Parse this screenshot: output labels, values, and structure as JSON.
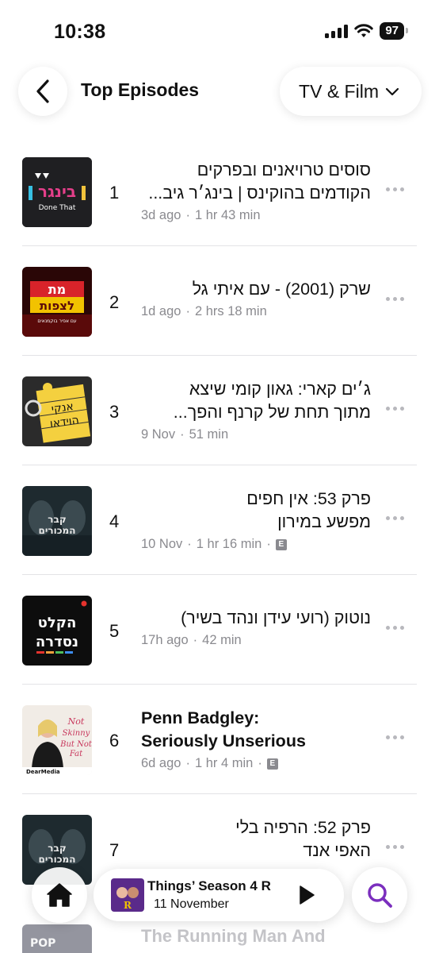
{
  "status_bar": {
    "time": "10:38",
    "battery": "97"
  },
  "header": {
    "back_icon": "chevron-left-icon",
    "title": "Top Episodes",
    "filter_label": "TV & Film",
    "filter_icon": "chevron-down-icon"
  },
  "episodes": [
    {
      "rank": "1",
      "title_line1": "סוסים טרויאנים ובפרקים",
      "title_line2": "הקודמים בהוקינס | בינג׳ר גיב...",
      "date": "3d ago",
      "duration": "1 hr 43 min",
      "explicit": false,
      "artwork_text": "בינגר",
      "artwork_sub": "Done That"
    },
    {
      "rank": "2",
      "title_line1": "שרק (2001) - עם איתי גל",
      "title_line2": "",
      "date": "1d ago",
      "duration": "2 hrs 18 min",
      "explicit": false,
      "artwork_text": "מת לצפות",
      "artwork_sub": "עם אפיר בוקמנאים"
    },
    {
      "rank": "3",
      "title_line1": "ג׳ים קארי: גאון קומי שיצא",
      "title_line2": "מתוך תחת של קרנף והפך...",
      "date": "9 Nov",
      "duration": "51 min",
      "explicit": false,
      "artwork_text": "אנקי הוידאו",
      "artwork_sub": ""
    },
    {
      "rank": "4",
      "title_line1": "פרק 53: אין חפים",
      "title_line2": "מפשע במירון",
      "date": "10 Nov",
      "duration": "1 hr 16 min",
      "explicit": true,
      "artwork_text": "קבר המכורים",
      "artwork_sub": ""
    },
    {
      "rank": "5",
      "title_line1": "נוטוק (רועי עידן ונהד בשיר)",
      "title_line2": "",
      "date": "17h ago",
      "duration": "42 min",
      "explicit": false,
      "artwork_text": "הקלט נסדרה",
      "artwork_sub": ""
    },
    {
      "rank": "6",
      "title_line1": "Penn Badgley:",
      "title_line2": "Seriously Unserious",
      "date": "6d ago",
      "duration": "1 hr 4 min",
      "explicit": true,
      "artwork_text": "Not Skinny But Not Fat",
      "artwork_sub": "DearMedia"
    },
    {
      "rank": "7",
      "title_line1": "פרק 52: הרפיה בלי",
      "title_line2": "האפי אנד",
      "date": "",
      "duration": "",
      "explicit": false,
      "artwork_text": "קבר המכורים",
      "artwork_sub": ""
    }
  ],
  "peek_row": {
    "title": "The Running Man And",
    "artwork_text": "POP"
  },
  "explicit_badge": "E",
  "separator": "·",
  "bottom_bar": {
    "home_icon": "house-icon",
    "now_playing_title": "Things’ Season 4 R",
    "now_playing_subtitle": "11 November",
    "play_icon": "play-icon",
    "search_icon": "search-icon"
  },
  "colors": {
    "accent": "#7b2fbe",
    "secondary_text": "#8a8a8f",
    "divider": "#e3e3e6"
  }
}
